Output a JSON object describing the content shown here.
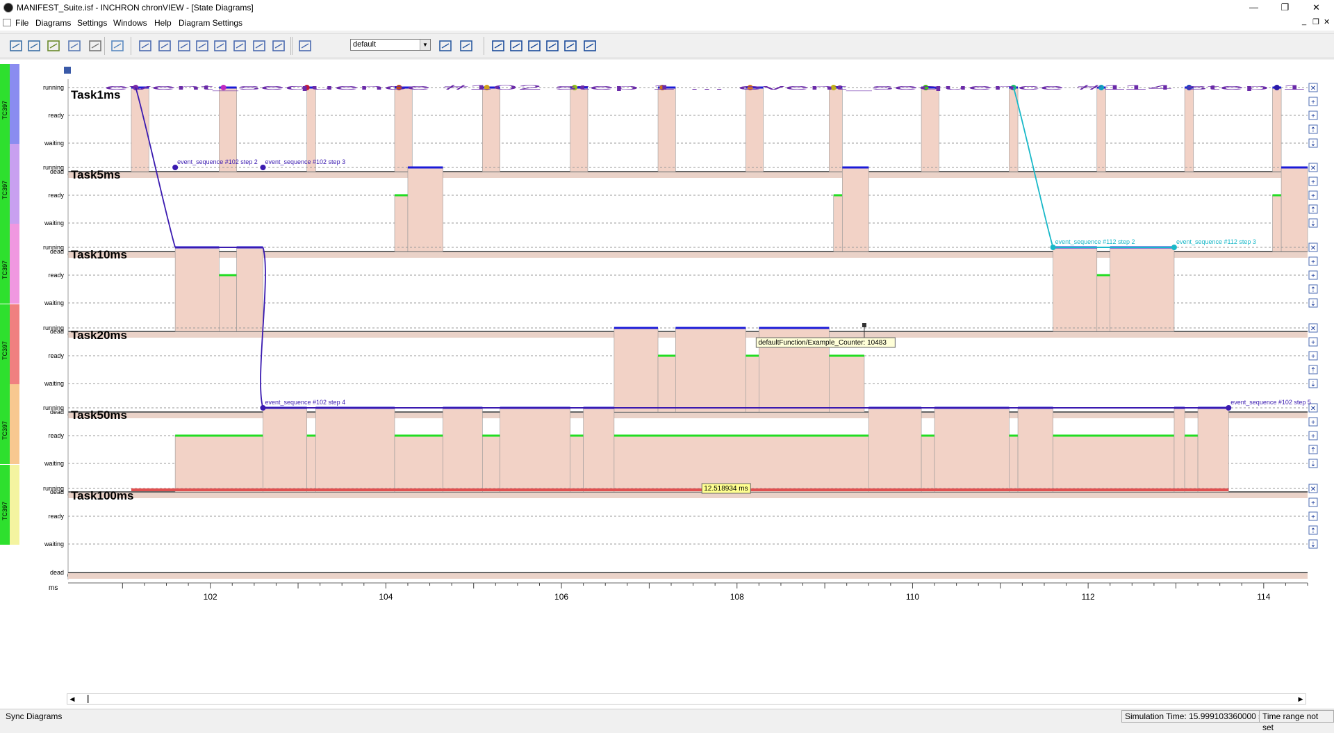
{
  "window": {
    "title": "MANIFEST_Suite.isf  -  INCHRON chronVIEW - [State Diagrams]",
    "minimize": "—",
    "maximize": "❐",
    "close": "✕"
  },
  "menu": [
    {
      "label": "File"
    },
    {
      "label": "Diagrams"
    },
    {
      "label": "Settings"
    },
    {
      "label": "Windows"
    },
    {
      "label": "Help"
    },
    {
      "label": "Diagram Settings"
    }
  ],
  "mdi": {
    "minimize": "_",
    "restore": "❐",
    "close": "✕"
  },
  "toolbar": {
    "preset_value": "default",
    "icons": [
      "open-icon",
      "save-icon",
      "export-icon",
      "import-icon",
      "print-icon",
      "globe-icon",
      "state-diagram-icon",
      "gantt-icon",
      "stack-icon",
      "bar-icon",
      "line-icon",
      "split-icon",
      "marker-icon",
      "histogram-icon",
      "chart-icon",
      "settings-a-icon",
      "settings-b-icon",
      "zoom-in-icon",
      "zoom-reset-icon",
      "zoom-out-icon",
      "zoom-fit-icon",
      "zoom-minus-icon",
      "rows-icon"
    ]
  },
  "diagram": {
    "core_label": "TC397",
    "state_labels": [
      "running",
      "ready",
      "waiting",
      "dead"
    ],
    "time_unit": "ms",
    "x_ticks": [
      102,
      104,
      106,
      108,
      110,
      112,
      114
    ],
    "lane_buttons": [
      "✕",
      "+",
      "+",
      "⇡",
      "⇣"
    ],
    "tasks": [
      {
        "name": "Task1ms",
        "color": "#8a8cf0"
      },
      {
        "name": "Task5ms",
        "color": "#c8a0f0"
      },
      {
        "name": "Task10ms",
        "color": "#f098e0"
      },
      {
        "name": "Task20ms",
        "color": "#f08080"
      },
      {
        "name": "Task50ms",
        "color": "#f8c890"
      },
      {
        "name": "Task100ms",
        "color": "#f4f4a0"
      }
    ],
    "event_labels": [
      "event_sequence #102 step 2",
      "event_sequence #102 step 3",
      "event_sequence #112 step 2",
      "event_sequence #112 step 3",
      "event_sequence #102 step 4",
      "event_sequence #102 step 5"
    ],
    "task1_marker_text": "event_sequence #102 step 1 ... event_sequence #114 step 1",
    "tooltip": "defaultFunction/Example_Counter: 10483",
    "duration_label": "12.518934 ms"
  },
  "status": {
    "left": "Sync Diagrams",
    "simulation_time": "Simulation Time: 15.999103360000 s",
    "time_range": "Time range not set"
  }
}
